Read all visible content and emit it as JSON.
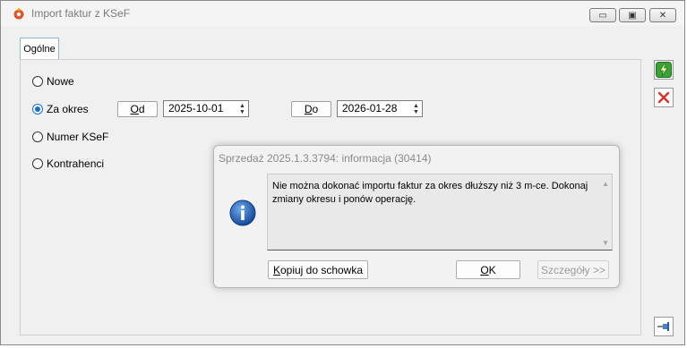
{
  "window": {
    "title": "Import faktur z KSeF",
    "controls": {
      "minimize": "▭",
      "restore": "▣",
      "close": "✕"
    }
  },
  "tabs": [
    {
      "label": "Ogólne"
    }
  ],
  "options": {
    "nowe": "Nowe",
    "za_okres": "Za okres",
    "numer_ksef": "Numer KSeF",
    "kontrahenci": "Kontrahenci",
    "selected": "za_okres"
  },
  "period": {
    "from_label_prefix": "O",
    "from_label_rest": "d",
    "from_value": "2025-10-01",
    "to_label_prefix": "D",
    "to_label_rest": "o",
    "to_value": "2026-01-28"
  },
  "side_buttons": {
    "run_icon": "lightning-icon",
    "cancel_icon": "red-x-icon",
    "pin_icon": "pin-icon"
  },
  "dialog": {
    "title": "Sprzedaż 2025.1.3.3794: informacja (30414)",
    "message": "Nie można dokonać importu faktur za okres dłuższy niż 3 m-ce. Dokonaj zmiany okresu i ponów operację.",
    "copy_prefix": "K",
    "copy_rest": "opiuj do schowka",
    "ok_prefix": "O",
    "ok_rest": "K",
    "details_label": "Szczegóły >>"
  },
  "colors": {
    "accent": "#1a6dc9",
    "run_green": "#3aa336",
    "cancel_red": "#d9302b"
  }
}
